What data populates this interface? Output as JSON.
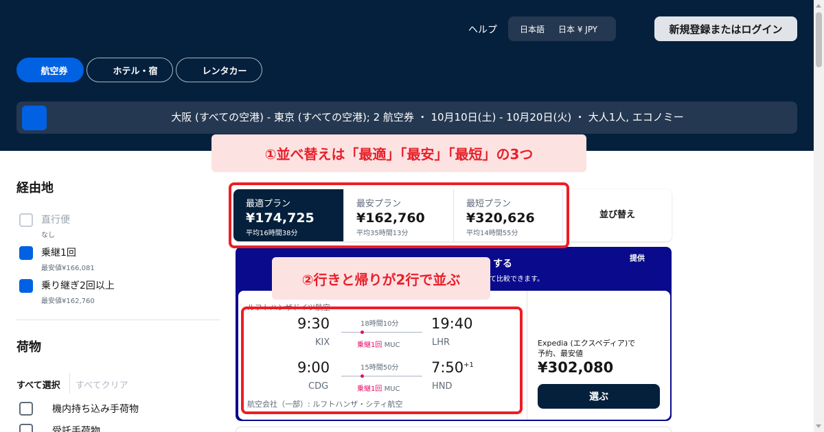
{
  "header": {
    "help": "ヘルプ",
    "language": "日本語",
    "region_currency": "日本 ¥ JPY",
    "login": "新規登録またはログイン"
  },
  "tabs": [
    {
      "label": "航空券",
      "active": true
    },
    {
      "label": "ホテル・宿",
      "active": false
    },
    {
      "label": "レンタカー",
      "active": false
    }
  ],
  "search": {
    "summary": "大阪 (すべての空港) - 東京 (すべての空港); 2 航空券 ・ 10月10日(土) - 10月20日(火) ・ 大人1人, エコノミー"
  },
  "filters": {
    "stops_title": "経由地",
    "stops": [
      {
        "label": "直行便",
        "sub": "なし",
        "checked": false,
        "disabled": true
      },
      {
        "label": "乗継1回",
        "sub": "最安値¥166,081",
        "checked": true,
        "disabled": false
      },
      {
        "label": "乗り継ぎ2回以上",
        "sub": "最安値¥162,760",
        "checked": true,
        "disabled": false
      }
    ],
    "baggage_title": "荷物",
    "select_all": "すべて選択",
    "clear_all": "すべてクリア",
    "baggage": [
      {
        "label": "機内持ち込み手荷物",
        "checked": false
      },
      {
        "label": "受託手荷物",
        "checked": false
      }
    ]
  },
  "sort": {
    "options": [
      {
        "label": "最適プラン",
        "price": "¥174,725",
        "duration": "平均16時間38分",
        "active": true
      },
      {
        "label": "最安プラン",
        "price": "¥162,760",
        "duration": "平均35時間13分",
        "active": false
      },
      {
        "label": "最短プラン",
        "price": "¥320,626",
        "duration": "平均14時間55分",
        "active": false
      }
    ],
    "sort_by": "並び替え"
  },
  "sponsored": {
    "heading": "する",
    "subtext": "て比較できます。",
    "provided": "提供"
  },
  "result": {
    "airline_top": "ルフトハンザドイツ航空",
    "legs": [
      {
        "dep_time": "9:30",
        "dep_code": "KIX",
        "duration": "18時間10分",
        "stops": "乗継1回",
        "via": "MUC",
        "arr_time": "19:40",
        "arr_code": "LHR",
        "day_offset": ""
      },
      {
        "dep_time": "9:00",
        "dep_code": "CDG",
        "duration": "15時間50分",
        "stops": "乗継1回",
        "via": "MUC",
        "arr_time": "7:50",
        "arr_code": "HND",
        "day_offset": "+1"
      }
    ],
    "airline_bottom": "航空会社（一部）: ルフトハンザ・シティ航空",
    "agent_line1": "Expedia (エクスペディア)で",
    "agent_line2": "予約、最安値",
    "price": "¥302,080",
    "select": "選ぶ"
  },
  "annotations": {
    "note1": "①並べ替えは「最適」「最安」「最短」の3つ",
    "note2": "②行きと帰りが2行で並ぶ"
  },
  "colors": {
    "header_bg": "#05203c",
    "accent_blue": "#0062e3",
    "stop_pink": "#e70866",
    "annotation_red": "#ee1c24",
    "sponsored_bg": "#0a0a8c"
  }
}
